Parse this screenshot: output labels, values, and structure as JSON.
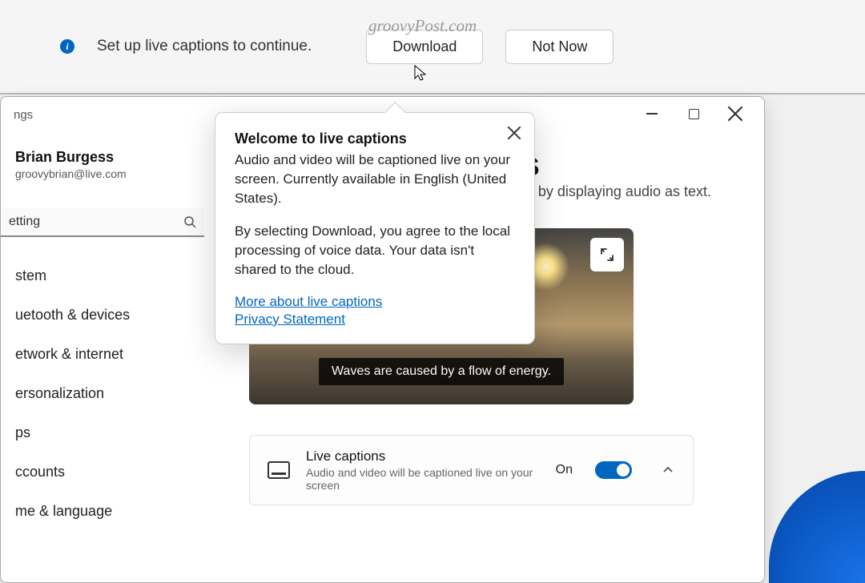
{
  "watermark": "groovyPost.com",
  "notification": {
    "text": "Set up live captions to continue.",
    "download": "Download",
    "notnow": "Not Now"
  },
  "window": {
    "title_fragment": "ngs"
  },
  "user": {
    "name": "Brian Burgess",
    "email": "groovybrian@live.com"
  },
  "search": {
    "placeholder": "etting"
  },
  "nav": {
    "items": [
      "stem",
      "uetooth & devices",
      "etwork & internet",
      "ersonalization",
      "ps",
      "ccounts",
      "me & language"
    ]
  },
  "page": {
    "title_fragment": "ons",
    "desc_fragment": "nd by displaying audio as text.",
    "caption_text": "Waves are caused by a flow of energy."
  },
  "setting": {
    "label": "Live captions",
    "sub": "Audio and video will be captioned live on your screen",
    "state": "On"
  },
  "popup": {
    "title": "Welcome to live captions",
    "p1": "Audio and video will be captioned live on your screen. Currently available in English (United States).",
    "p2": "By selecting Download, you agree to the local processing of voice data. Your data isn't shared to the cloud.",
    "link1": "More about live captions",
    "link2": "Privacy Statement"
  }
}
